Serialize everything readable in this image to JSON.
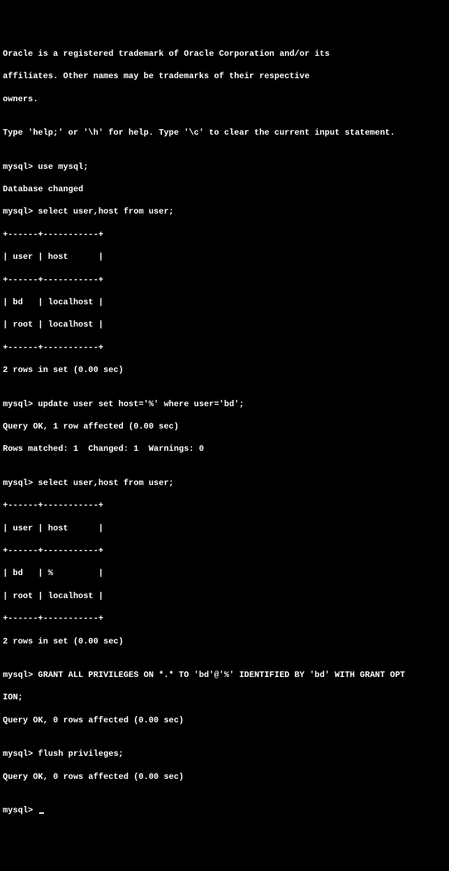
{
  "intro": {
    "line1": "Oracle is a registered trademark of Oracle Corporation and/or its",
    "line2": "affiliates. Other names may be trademarks of their respective",
    "line3": "owners.",
    "blank": "",
    "help": "Type 'help;' or '\\h' for help. Type '\\c' to clear the current input statement."
  },
  "prompt": "mysql>",
  "blocks": {
    "use_db": {
      "cmd": "use mysql;",
      "resp": "Database changed"
    },
    "select1": {
      "cmd": "select user,host from user;",
      "border": "+------+-----------+",
      "header": "| user | host      |",
      "row1": "| bd   | localhost |",
      "row2": "| root | localhost |",
      "footer": "2 rows in set (0.00 sec)"
    },
    "update": {
      "cmd": "update user set host='%' where user='bd';",
      "resp1": "Query OK, 1 row affected (0.00 sec)",
      "resp2": "Rows matched: 1  Changed: 1  Warnings: 0"
    },
    "select2": {
      "cmd": "select user,host from user;",
      "border": "+------+-----------+",
      "header": "| user | host      |",
      "row1": "| bd   | %         |",
      "row2": "| root | localhost |",
      "footer": "2 rows in set (0.00 sec)"
    },
    "grant": {
      "cmd1": "GRANT ALL PRIVILEGES ON *.* TO 'bd'@'%' IDENTIFIED BY 'bd' WITH GRANT OPT",
      "cmd2": "ION;",
      "resp": "Query OK, 0 rows affected (0.00 sec)"
    },
    "flush": {
      "cmd": "flush privileges;",
      "resp": "Query OK, 0 rows affected (0.00 sec)"
    }
  }
}
